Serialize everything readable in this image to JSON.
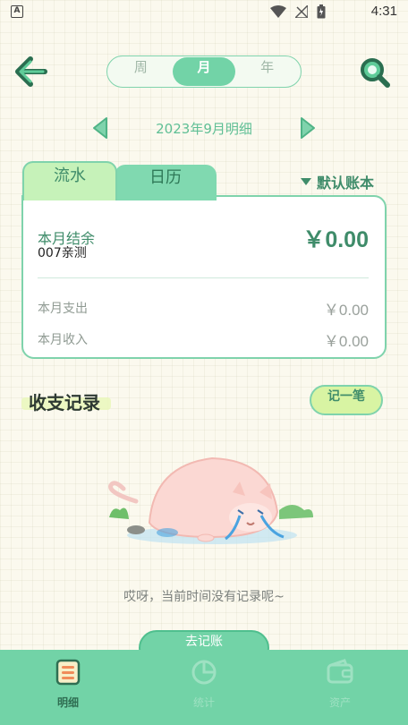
{
  "status_bar": {
    "time": "4:31",
    "app_badge": "A"
  },
  "header": {
    "periods": [
      {
        "label": "周",
        "active": false
      },
      {
        "label": "月",
        "active": true
      },
      {
        "label": "年",
        "active": false
      }
    ],
    "month_label": "2023年9月明细"
  },
  "card": {
    "tabs": [
      {
        "label": "流水",
        "active": true
      },
      {
        "label": "日历",
        "active": false
      }
    ],
    "account_book": "默认账本",
    "balance_label": "本月结余",
    "balance_sub": "007亲测",
    "balance_value": "￥0.00",
    "expense_label": "本月支出",
    "expense_value": "￥0.00",
    "income_label": "本月收入",
    "income_value": "￥0.00"
  },
  "records": {
    "title": "收支记录",
    "add_button": "记一笔",
    "empty_text": "哎呀，当前时间没有记录呢~"
  },
  "floating_button": {
    "label": "去记账"
  },
  "bottom_nav": {
    "items": [
      {
        "label": "明细",
        "icon": "list-icon",
        "active": true
      },
      {
        "label": "统计",
        "icon": "pie-chart-icon",
        "active": false
      },
      {
        "label": "资产",
        "icon": "wallet-icon",
        "active": false
      }
    ]
  },
  "colors": {
    "accent": "#72d3a7",
    "accent_dark": "#3f8c6a",
    "tab_active": "#c6f2b9",
    "background": "#fbf9ee"
  }
}
